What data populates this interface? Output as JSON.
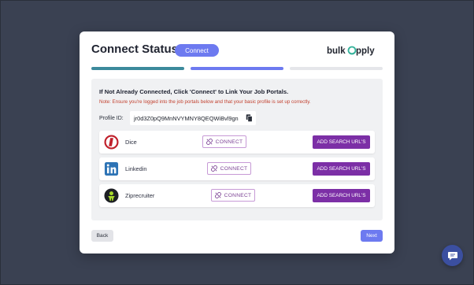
{
  "modal": {
    "title": "Connect Status",
    "status_pill": "Connect",
    "logo_text": "bulkapply"
  },
  "progress": {
    "steps": 3,
    "active": 2
  },
  "panel": {
    "instruction": "If Not Already Connected, Click 'Connect' to Link Your Job Portals.",
    "note": "Note: Ensure you're logged into the job portals below and that your basic profile is set up correctly.",
    "profile_label": "Profile ID:",
    "profile_id": "jr0d3Z0pQ9MnNVYMNY8QEQWiBvl9gn"
  },
  "portals": [
    {
      "name": "Dice",
      "connect_label": "CONNECT",
      "add_label": "ADD SEARCH URL'S",
      "icon": "dice-icon"
    },
    {
      "name": "Linkedin",
      "connect_label": "CONNECT",
      "add_label": "ADD SEARCH URL'S",
      "icon": "linkedin-icon"
    },
    {
      "name": "Ziprecruiter",
      "connect_label": "CONNECT",
      "add_label": "ADD SEARCH URL'S",
      "icon": "ziprecruiter-icon"
    }
  ],
  "footer": {
    "back_label": "Back",
    "next_label": "Next"
  },
  "colors": {
    "background": "#3b4252",
    "accent": "#6d7af0",
    "purple_button": "#7c2fa6",
    "note_red": "#c2412f",
    "progress_teal": "#3c8a9c"
  }
}
